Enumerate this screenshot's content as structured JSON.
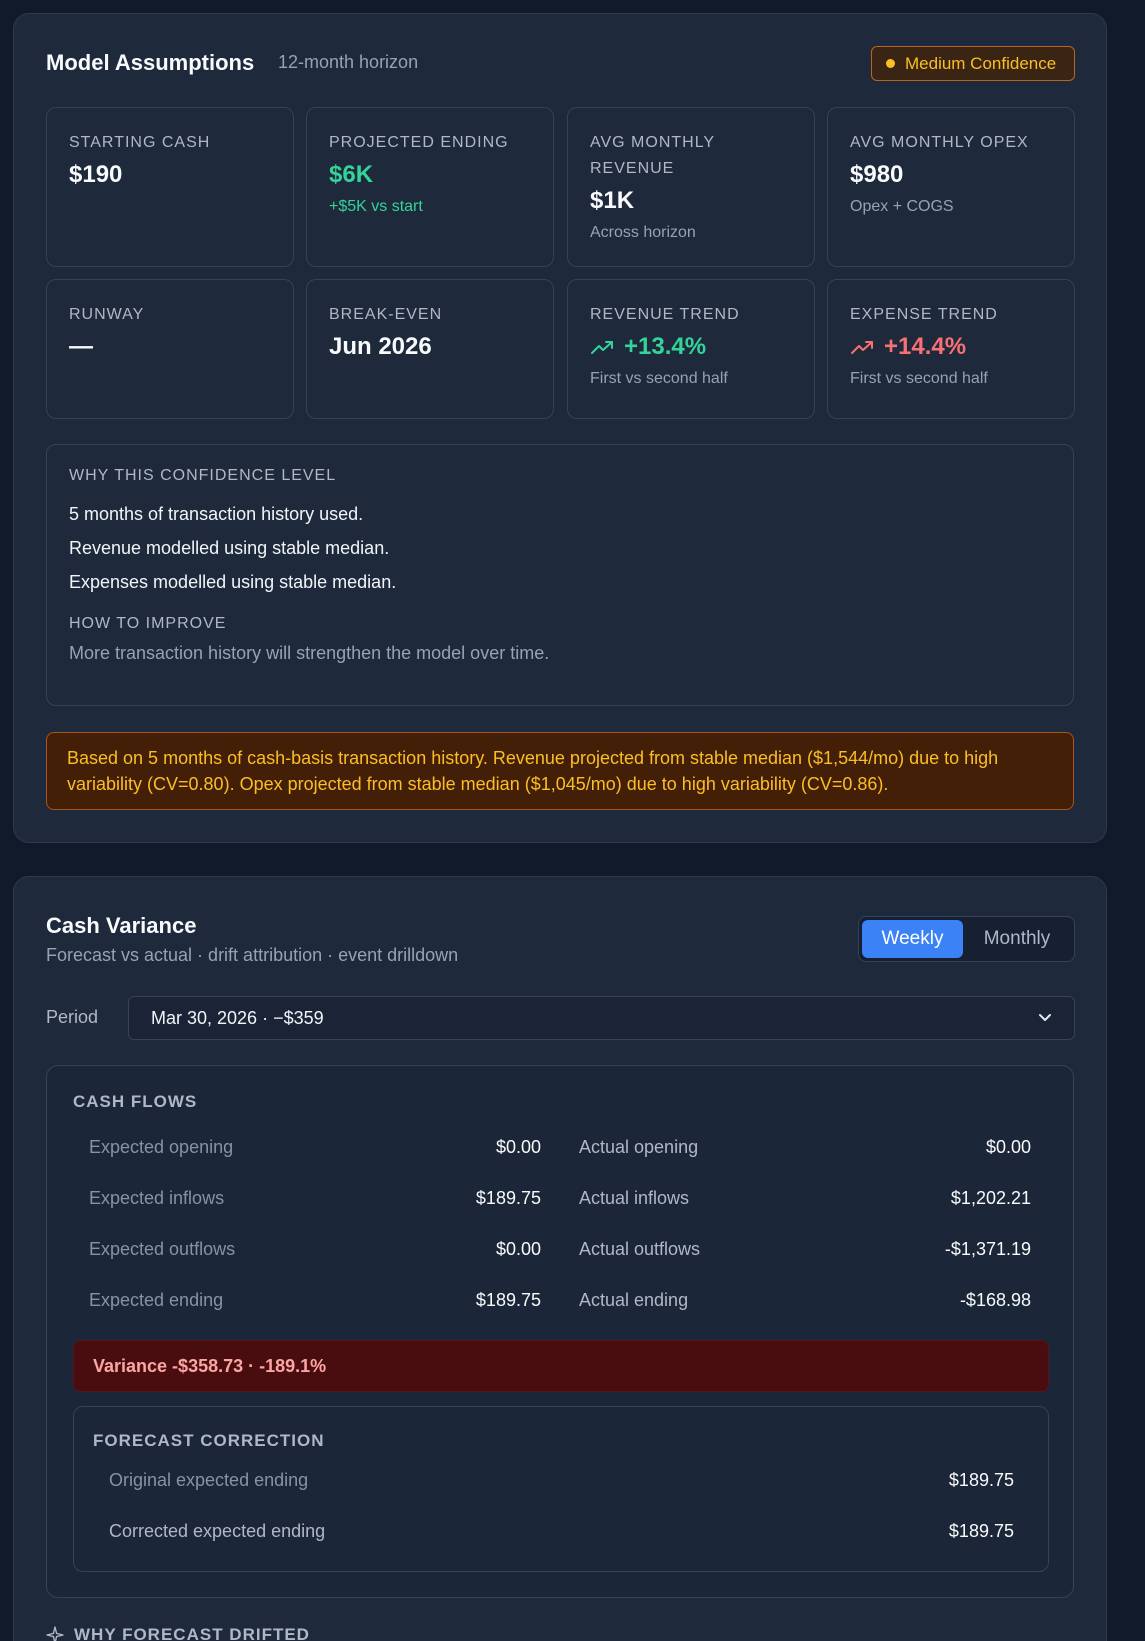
{
  "assumptions": {
    "title": "Model Assumptions",
    "horizon": "12-month horizon",
    "confidence_badge": "Medium Confidence",
    "metrics": [
      {
        "label": "STARTING CASH",
        "value": "$190",
        "note": ""
      },
      {
        "label": "PROJECTED ENDING",
        "value": "$6K",
        "note": "+$5K vs start"
      },
      {
        "label": "AVG MONTHLY REVENUE",
        "value": "$1K",
        "note": "Across horizon"
      },
      {
        "label": "AVG MONTHLY OPEX",
        "value": "$980",
        "note": "Opex + COGS"
      },
      {
        "label": "RUNWAY",
        "value": "—",
        "note": ""
      },
      {
        "label": "BREAK-EVEN",
        "value": "Jun 2026",
        "note": ""
      },
      {
        "label": "REVENUE TREND",
        "value": "+13.4%",
        "note": "First vs second half"
      },
      {
        "label": "EXPENSE TREND",
        "value": "+14.4%",
        "note": "First vs second half"
      }
    ],
    "why": {
      "label": "WHY THIS CONFIDENCE LEVEL",
      "lines": [
        "5 months of transaction history used.",
        "Revenue modelled using stable median.",
        "Expenses modelled using stable median."
      ],
      "improve_label": "HOW TO IMPROVE",
      "improve_text": "More transaction history will strengthen the model over time."
    },
    "warning": "Based on 5 months of cash-basis transaction history. Revenue projected from stable median ($1,544/mo) due to high variability (CV=0.80). Opex projected from stable median ($1,045/mo) due to high variability (CV=0.86).",
    "colors": {
      "positive": "#34d399",
      "negative": "#f87171",
      "warning": "#fbbf24"
    },
    "icons": {
      "trend_up": "trending-up-icon",
      "badge_dot": "dot-icon"
    }
  },
  "variance": {
    "title": "Cash Variance",
    "subtitle": "Forecast vs actual · drift attribution · event drilldown",
    "toggle": {
      "weekly": "Weekly",
      "monthly": "Monthly",
      "selected": "Weekly"
    },
    "period_label": "Period",
    "period_value": "Mar 30, 2026 · −$359",
    "cash_flows_label": "CASH FLOWS",
    "expected": [
      {
        "label": "Expected opening",
        "value": "$0.00"
      },
      {
        "label": "Expected inflows",
        "value": "$189.75"
      },
      {
        "label": "Expected outflows",
        "value": "$0.00"
      },
      {
        "label": "Expected ending",
        "value": "$189.75"
      }
    ],
    "actual": [
      {
        "label": "Actual opening",
        "value": "$0.00"
      },
      {
        "label": "Actual inflows",
        "value": "$1,202.21"
      },
      {
        "label": "Actual outflows",
        "value": "-$1,371.19"
      },
      {
        "label": "Actual ending",
        "value": "-$168.98"
      }
    ],
    "variance_text": "Variance -$358.73 · -189.1%",
    "correction": {
      "label": "FORECAST CORRECTION",
      "rows": [
        {
          "label": "Original expected ending",
          "value": "$189.75"
        },
        {
          "label": "Corrected expected ending",
          "value": "$189.75"
        }
      ]
    },
    "drift_label": "WHY FORECAST DRIFTED",
    "accent": "#3b82f6"
  }
}
